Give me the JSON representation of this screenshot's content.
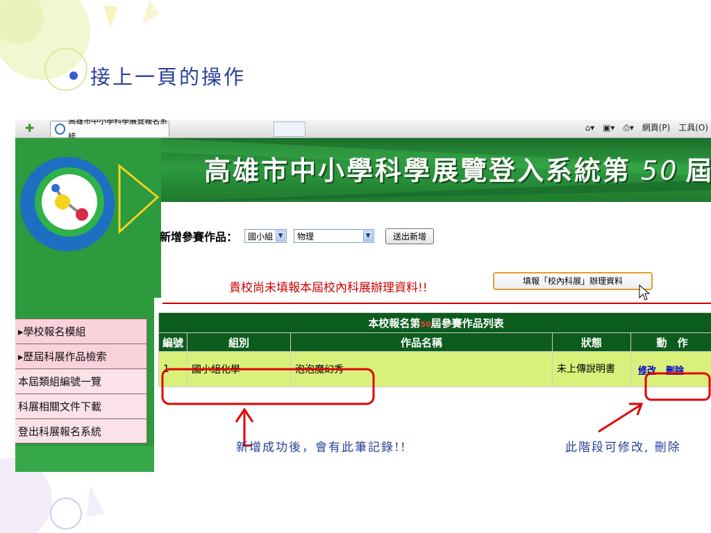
{
  "slide": {
    "title": "接上一頁的操作",
    "bullet_color": "#3a5bd0"
  },
  "browser": {
    "tab_title": "高雄市中小學科學展覽報名系統",
    "menu_page": "網頁(P)",
    "menu_tools": "工具(O)"
  },
  "banner": {
    "title_prefix": "高雄市中小學科學展覽登入系統第",
    "number": "50",
    "title_suffix": "屆"
  },
  "sidebar": {
    "items": [
      {
        "label": "▸學校報名模組"
      },
      {
        "label": "▸歷屆科展作品檢索"
      },
      {
        "label": "本屆類組編號一覽"
      },
      {
        "label": "科展相關文件下載"
      },
      {
        "label": "登出科展報名系統"
      }
    ]
  },
  "form": {
    "add_label": "新增參賽作品：",
    "group_select": "國小組",
    "subject_select": "物理",
    "submit_button": "送出新增"
  },
  "notice": {
    "warning_text": "貴校尚未填報本屆校內科展辦理資料!!",
    "fill_button": "填報「校內科展」辦理資料"
  },
  "table": {
    "caption_prefix": "本校報名第",
    "caption_number": "50",
    "caption_suffix": "屆參賽作品列表",
    "headers": [
      "編號",
      "組別",
      "作品名稱",
      "狀態",
      "動　作"
    ],
    "rows": [
      {
        "id": "1",
        "group": "國小組化學",
        "name": "泡泡魔幻秀",
        "status": "未上傳說明書",
        "edit": "修改",
        "delete": "刪除"
      }
    ]
  },
  "annotations": {
    "left": "新增成功後，會有此筆記錄!!",
    "right": "此階段可修改, 刪除"
  },
  "colors": {
    "accent_red": "#cc0000",
    "header_green": "#0c5c1e",
    "row_lime": "#d9f07a",
    "sidebar_pink": "#fad2dc"
  }
}
